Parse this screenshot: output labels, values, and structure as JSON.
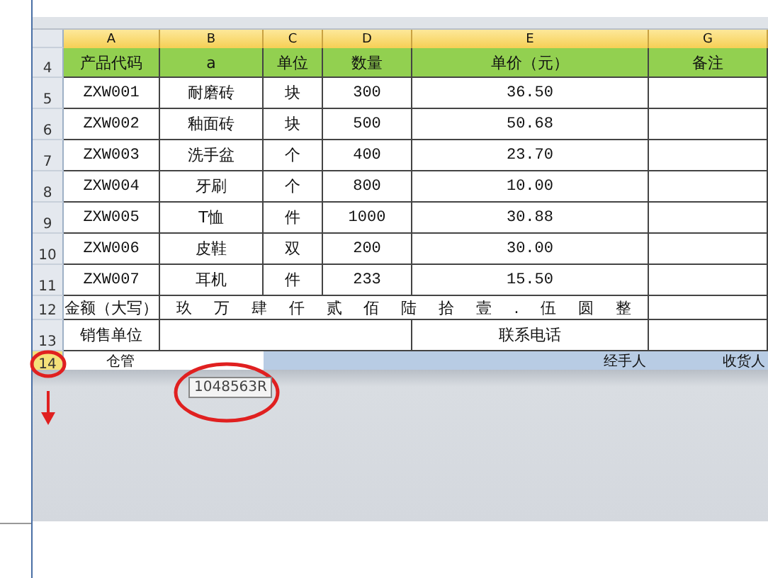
{
  "columns": [
    "A",
    "B",
    "C",
    "D",
    "E",
    "G"
  ],
  "header_row": {
    "row_number": "4",
    "cells": [
      "产品代码",
      "a",
      "单位",
      "数量",
      "单价（元）",
      "备注"
    ]
  },
  "rows": [
    {
      "row_number": "5",
      "code": "ZXW001",
      "name": "耐磨砖",
      "unit": "块",
      "qty": "300",
      "price": "36.50"
    },
    {
      "row_number": "6",
      "code": "ZXW002",
      "name": "釉面砖",
      "unit": "块",
      "qty": "500",
      "price": "50.68"
    },
    {
      "row_number": "7",
      "code": "ZXW003",
      "name": "洗手盆",
      "unit": "个",
      "qty": "400",
      "price": "23.70"
    },
    {
      "row_number": "8",
      "code": "ZXW004",
      "name": "牙刷",
      "unit": "个",
      "qty": "800",
      "price": "10.00"
    },
    {
      "row_number": "9",
      "code": "ZXW005",
      "name": "T恤",
      "unit": "件",
      "qty": "1000",
      "price": "30.88"
    },
    {
      "row_number": "10",
      "code": "ZXW006",
      "name": "皮鞋",
      "unit": "双",
      "qty": "200",
      "price": "30.00"
    },
    {
      "row_number": "11",
      "code": "ZXW007",
      "name": "耳机",
      "unit": "件",
      "qty": "233",
      "price": "15.50"
    }
  ],
  "total_row": {
    "row_number": "12",
    "label": "金额（大写）",
    "value": "玖 万 肆 仟 贰 佰 陆 拾 壹 . 伍 圆 整"
  },
  "seller_row": {
    "row_number": "13",
    "label": "销售单位",
    "phone_label": "联系电话"
  },
  "sign_row": {
    "row_number": "14",
    "selected": true,
    "cells": [
      "仓管",
      "经手人",
      "收货人"
    ]
  },
  "tooltip": "1048563R"
}
